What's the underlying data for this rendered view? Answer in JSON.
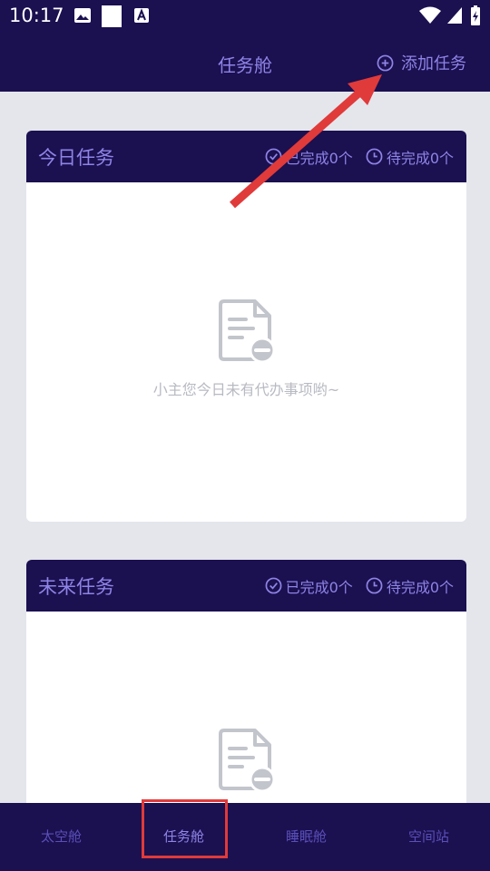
{
  "status_bar": {
    "time": "10:17"
  },
  "header": {
    "title": "任务舱",
    "add_task_label": "添加任务"
  },
  "cards": [
    {
      "title": "今日任务",
      "completed_label": "已完成0个",
      "pending_label": "待完成0个",
      "empty_text": "小主您今日未有代办事项哟~"
    },
    {
      "title": "未来任务",
      "completed_label": "已完成0个",
      "pending_label": "待完成0个"
    }
  ],
  "bottom_nav": {
    "items": [
      {
        "label": "太空舱"
      },
      {
        "label": "任务舱"
      },
      {
        "label": "睡眠舱"
      },
      {
        "label": "空间站"
      }
    ],
    "active": "任务舱"
  },
  "colors": {
    "bar_bg": "#1b1050",
    "accent": "#8e84e6",
    "page_bg": "#e4e6ec",
    "annotation": "#e03a3a"
  }
}
